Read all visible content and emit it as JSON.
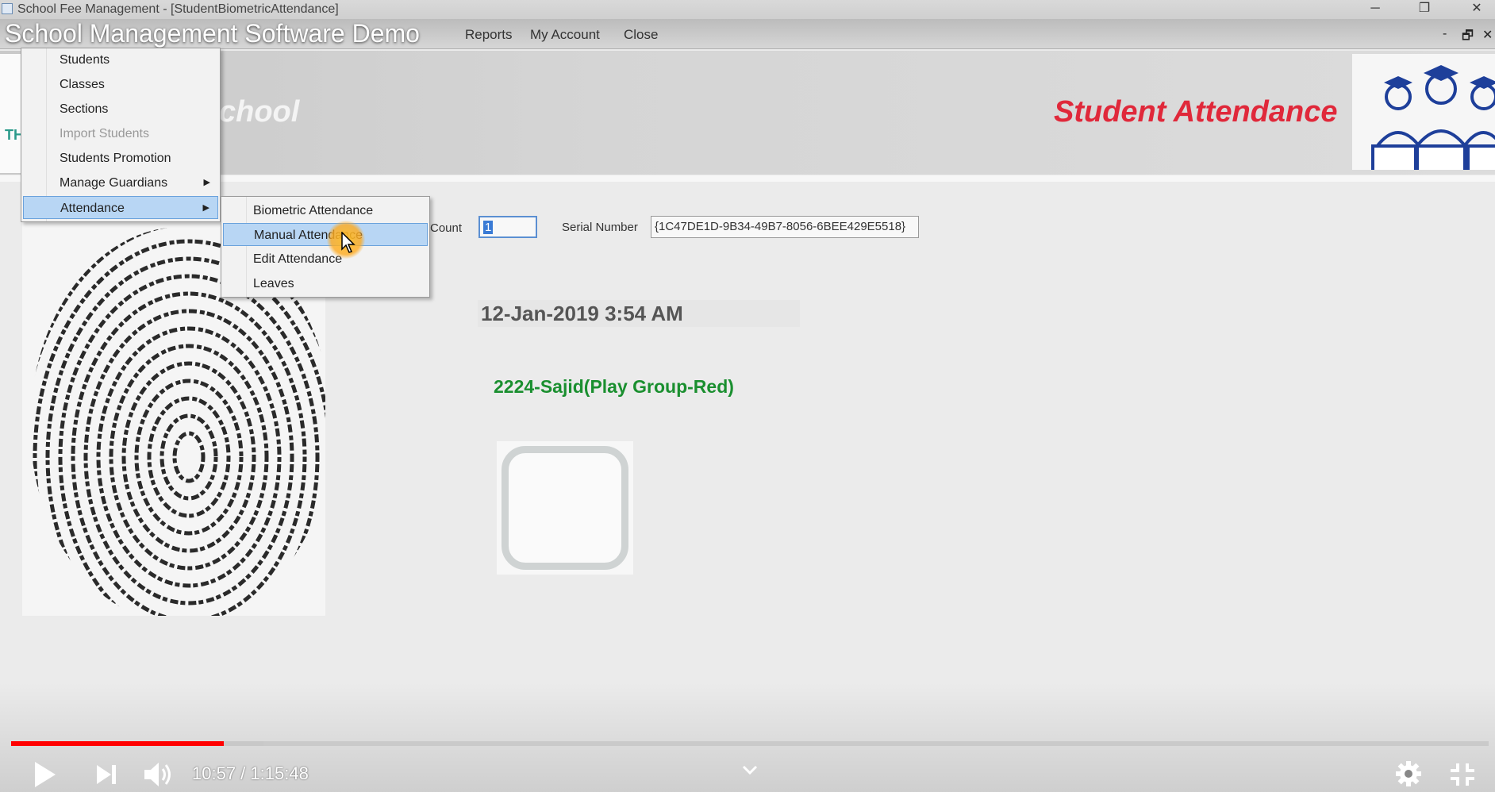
{
  "window": {
    "title": "School Fee Management - [StudentBiometricAttendance]",
    "minimize": "─",
    "restore": "❐",
    "close": "✕"
  },
  "menubar": {
    "items": [
      "Reports",
      "My Account",
      "Close"
    ],
    "mdi_minimize": "-",
    "mdi_restore": "🗗",
    "mdi_close": "✕"
  },
  "video": {
    "title": "School Management Software Demo",
    "current_time": "10:57",
    "duration": "1:15:48",
    "time_separator": " / ",
    "progress_fraction": 0.144,
    "buffered_fraction": 0.171
  },
  "header": {
    "school_name_partial": "chool",
    "logo_text": "TH",
    "page_title": "Student Attendance"
  },
  "students_menu": {
    "items": [
      {
        "label": "Students"
      },
      {
        "label": "Classes"
      },
      {
        "label": "Sections"
      },
      {
        "label": "Import Students"
      },
      {
        "label": "Students Promotion"
      },
      {
        "label": "Manage Guardians",
        "arrow": "▶"
      },
      {
        "label": "Attendance",
        "arrow": "▶"
      }
    ]
  },
  "attendance_submenu": {
    "items": [
      {
        "label": "Biometric Attendance"
      },
      {
        "label": "Manual Attendance"
      },
      {
        "label": "Edit Attendance"
      },
      {
        "label": "Leaves"
      }
    ]
  },
  "form": {
    "count_label": "Count",
    "count_value": "1",
    "serial_label": "Serial Number",
    "serial_value": "{1C47DE1D-9B34-49B7-8056-6BEE429E5518}",
    "datetime": "12-Jan-2019 3:54 AM",
    "student": "2224-Sajid(Play Group-Red)"
  },
  "colors": {
    "page_title": "#e0283a",
    "student_text": "#1a8f2f",
    "menu_highlight": "#b8d6f4",
    "progress": "#ff0000"
  },
  "icons": {
    "play": "play-icon",
    "next": "next-icon",
    "volume": "volume-icon",
    "chevron": "chevron-down-icon",
    "settings": "gear-icon",
    "exit_fullscreen": "exit-fullscreen-icon"
  }
}
